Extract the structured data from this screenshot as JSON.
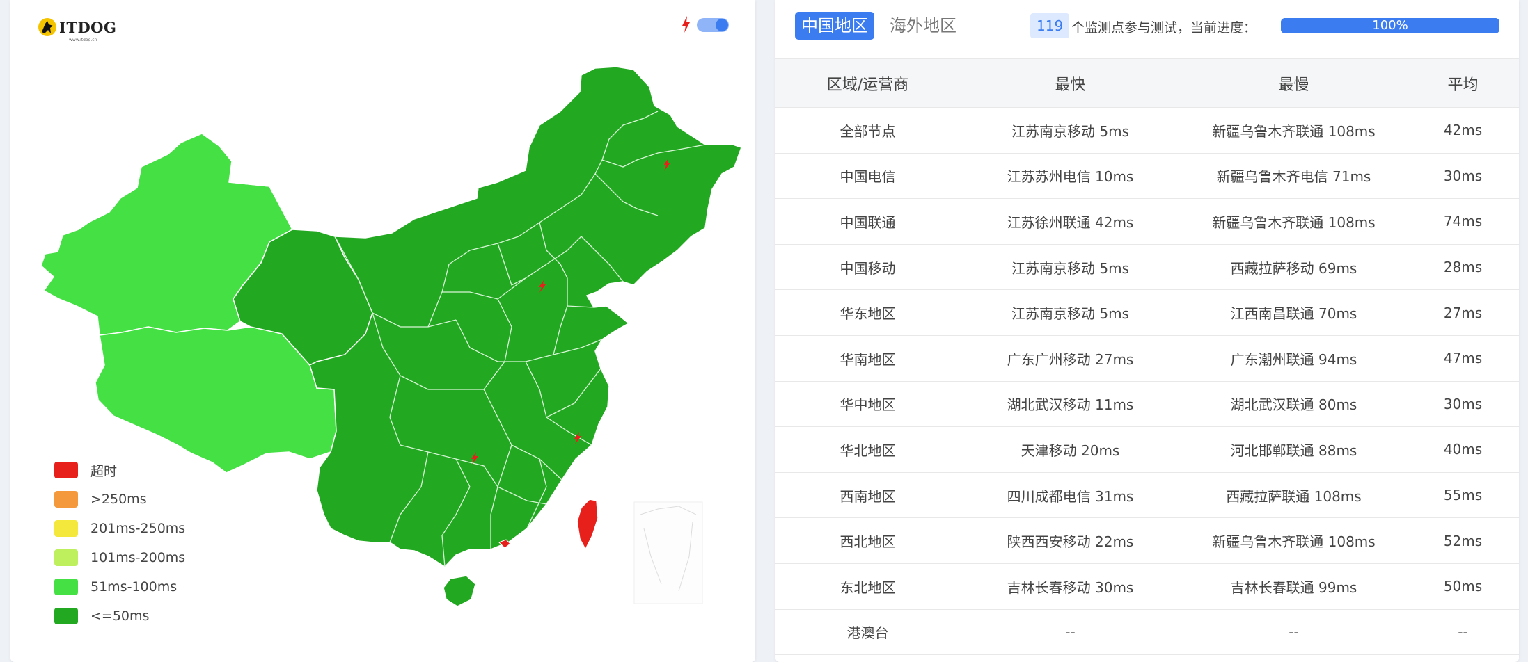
{
  "logo": {
    "text": "ITDOG",
    "subtext": "www.itdog.cn"
  },
  "legend": [
    {
      "label": "超时",
      "color": "#e8201c"
    },
    {
      "label": ">250ms",
      "color": "#f59a3c"
    },
    {
      "label": "201ms-250ms",
      "color": "#f5e83c"
    },
    {
      "label": "101ms-200ms",
      "color": "#bdf05c"
    },
    {
      "label": "51ms-100ms",
      "color": "#44e044"
    },
    {
      "label": "<=50ms",
      "color": "#23a821"
    }
  ],
  "tabs": [
    {
      "label": "中国地区",
      "active": true
    },
    {
      "label": "海外地区",
      "active": false
    }
  ],
  "monitor": {
    "count": "119",
    "text": "个监测点参与测试，当前进度：",
    "progress_label": "100%",
    "progress_value": 1.0
  },
  "table": {
    "headers": [
      "区域/运营商",
      "最快",
      "最慢",
      "平均"
    ],
    "rows": [
      [
        "全部节点",
        "江苏南京移动 5ms",
        "新疆乌鲁木齐联通 108ms",
        "42ms"
      ],
      [
        "中国电信",
        "江苏苏州电信 10ms",
        "新疆乌鲁木齐电信 71ms",
        "30ms"
      ],
      [
        "中国联通",
        "江苏徐州联通 42ms",
        "新疆乌鲁木齐联通 108ms",
        "74ms"
      ],
      [
        "中国移动",
        "江苏南京移动 5ms",
        "西藏拉萨移动 69ms",
        "28ms"
      ],
      [
        "华东地区",
        "江苏南京移动 5ms",
        "江西南昌联通 70ms",
        "27ms"
      ],
      [
        "华南地区",
        "广东广州移动 27ms",
        "广东潮州联通 94ms",
        "47ms"
      ],
      [
        "华中地区",
        "湖北武汉移动 11ms",
        "湖北武汉联通 80ms",
        "30ms"
      ],
      [
        "华北地区",
        "天津移动 20ms",
        "河北邯郸联通 88ms",
        "40ms"
      ],
      [
        "西南地区",
        "四川成都电信 31ms",
        "西藏拉萨联通 108ms",
        "55ms"
      ],
      [
        "西北地区",
        "陕西西安移动 22ms",
        "新疆乌鲁木齐联通 108ms",
        "52ms"
      ],
      [
        "东北地区",
        "吉林长春移动 30ms",
        "吉林长春联通 99ms",
        "50ms"
      ],
      [
        "港澳台",
        "--",
        "--",
        "--"
      ]
    ]
  },
  "colors": {
    "accent": "#3b7cf0",
    "map_fast": "#23a821",
    "map_medium": "#44e044",
    "map_timeout": "#e8201c"
  },
  "icons": {
    "lightning": "lightning-icon",
    "logo": "dog-logo-icon"
  }
}
